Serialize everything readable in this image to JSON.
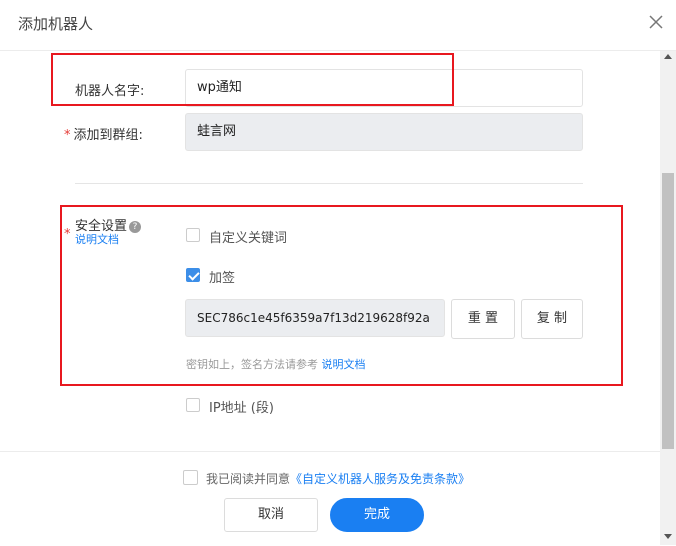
{
  "dialog": {
    "title": "添加机器人",
    "close_icon": "close-icon"
  },
  "form": {
    "robot_name_label": "机器人名字:",
    "robot_name_value": "wp通知",
    "required_mark": "*",
    "group_label": "添加到群组:",
    "group_value": "蛙言网",
    "security_label": "安全设置",
    "security_doc_link": "说明文档",
    "custom_keyword_label": "自定义关键词",
    "custom_keyword_checked": false,
    "sign_label": "加签",
    "sign_checked": true,
    "secret_value": "SEC786c1e45f6359a7f13d219628f92a",
    "reset_button": "重 置",
    "copy_button": "复 制",
    "hint_text": "密钥如上，签名方法请参考",
    "hint_link": "说明文档",
    "ip_label": "IP地址 (段)",
    "ip_checked": false
  },
  "footer": {
    "agree_text": "我已阅读并同意",
    "agree_link": "《自定义机器人服务及免责条款》",
    "agree_checked": false,
    "cancel_button": "取消",
    "done_button": "完成"
  },
  "colors": {
    "primary": "#1a7ff2",
    "highlight_box": "#e8181f",
    "required": "#e53935"
  }
}
